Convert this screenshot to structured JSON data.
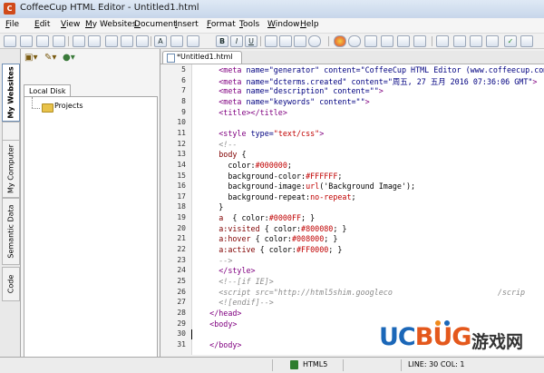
{
  "window": {
    "title": "CoffeeCup HTML Editor - Untitled1.html",
    "app_icon_letter": "C"
  },
  "menu": [
    "File",
    "Edit",
    "View",
    "My Websites",
    "Document",
    "Insert",
    "Format",
    "Tools",
    "Window",
    "Help"
  ],
  "toolbar": {
    "bold": "B",
    "italic": "I",
    "underline": "U",
    "font_icon": "A"
  },
  "side_tabs": [
    "My Websites",
    "My Computer",
    "Semantic Data",
    "Code"
  ],
  "side_panel": {
    "tab": "Local Disk",
    "tree": [
      "Projects"
    ]
  },
  "doc_tab": "*Untitled1.html",
  "editor": {
    "line_numbers": [
      "5",
      "6",
      "7",
      "8",
      "9",
      "10",
      "11",
      "12",
      "13",
      "14",
      "15",
      "16",
      "17",
      "18",
      "19",
      "20",
      "21",
      "22",
      "23",
      "24",
      "25",
      "26",
      "27",
      "28",
      "29",
      "30",
      "31"
    ],
    "lines": [
      [
        [
          "t-tag",
          "      <meta "
        ],
        [
          "t-attr",
          "name="
        ],
        [
          "t-str",
          "\"generator\""
        ],
        [
          "t-attr",
          " content="
        ],
        [
          "t-str",
          "\"CoffeeCup HTML Editor (www.coffeecup.com)\""
        ]
      ],
      [
        [
          "t-tag",
          "      <meta "
        ],
        [
          "t-attr",
          "name="
        ],
        [
          "t-str",
          "\"dcterms.created\""
        ],
        [
          "t-attr",
          " content="
        ],
        [
          "t-str",
          "\"周五, 27 五月 2016 07:36:06 GMT\""
        ],
        [
          "t-tag",
          ">"
        ]
      ],
      [
        [
          "t-tag",
          "      <meta "
        ],
        [
          "t-attr",
          "name="
        ],
        [
          "t-str",
          "\"description\""
        ],
        [
          "t-attr",
          " content="
        ],
        [
          "t-str",
          "\"\""
        ],
        [
          "t-tag",
          ">"
        ]
      ],
      [
        [
          "t-tag",
          "      <meta "
        ],
        [
          "t-attr",
          "name="
        ],
        [
          "t-str",
          "\"keywords\""
        ],
        [
          "t-attr",
          " content="
        ],
        [
          "t-str",
          "\"\""
        ],
        [
          "t-tag",
          ">"
        ]
      ],
      [
        [
          "t-tag",
          "      <title></title>"
        ]
      ],
      [
        [
          "t-txt",
          ""
        ]
      ],
      [
        [
          "t-tag",
          "      <style "
        ],
        [
          "t-attr",
          "type="
        ],
        [
          "t-val",
          "\"text/css\""
        ],
        [
          "t-tag",
          ">"
        ]
      ],
      [
        [
          "t-cmt",
          "      <!--"
        ]
      ],
      [
        [
          "t-sel",
          "      body "
        ],
        [
          "t-txt",
          "{"
        ]
      ],
      [
        [
          "t-prop",
          "        color:"
        ],
        [
          "t-val",
          "#000000"
        ],
        [
          "t-txt",
          ";"
        ]
      ],
      [
        [
          "t-prop",
          "        background-color:"
        ],
        [
          "t-val",
          "#FFFFFF"
        ],
        [
          "t-txt",
          ";"
        ]
      ],
      [
        [
          "t-prop",
          "        background-image:"
        ],
        [
          "t-val",
          "url"
        ],
        [
          "t-txt",
          "('Background Image');"
        ]
      ],
      [
        [
          "t-prop",
          "        background-repeat:"
        ],
        [
          "t-val",
          "no-repeat"
        ],
        [
          "t-txt",
          ";"
        ]
      ],
      [
        [
          "t-txt",
          "      }"
        ]
      ],
      [
        [
          "t-sel",
          "      a  "
        ],
        [
          "t-txt",
          "{ color:"
        ],
        [
          "t-val",
          "#0000FF"
        ],
        [
          "t-txt",
          "; }"
        ]
      ],
      [
        [
          "t-sel",
          "      a:visited "
        ],
        [
          "t-txt",
          "{ color:"
        ],
        [
          "t-val",
          "#800080"
        ],
        [
          "t-txt",
          "; }"
        ]
      ],
      [
        [
          "t-sel",
          "      a:hover "
        ],
        [
          "t-txt",
          "{ color:"
        ],
        [
          "t-val",
          "#008000"
        ],
        [
          "t-txt",
          "; }"
        ]
      ],
      [
        [
          "t-sel",
          "      a:active "
        ],
        [
          "t-txt",
          "{ color:"
        ],
        [
          "t-val",
          "#FF0000"
        ],
        [
          "t-txt",
          "; }"
        ]
      ],
      [
        [
          "t-cmt",
          "      -->"
        ]
      ],
      [
        [
          "t-tag",
          "      </style>"
        ]
      ],
      [
        [
          "t-cmt",
          "      <!--[if IE]>"
        ]
      ],
      [
        [
          "t-cmt",
          "      <script src=\"http://html5shim.googleco                       /scrip"
        ]
      ],
      [
        [
          "t-cmt",
          "      <![endif]-->"
        ]
      ],
      [
        [
          "t-tag",
          "    </head>"
        ]
      ],
      [
        [
          "t-tag",
          "    <body>"
        ]
      ],
      [
        [
          "t-txt",
          ""
        ]
      ],
      [
        [
          "t-tag",
          "    </body>"
        ]
      ]
    ]
  },
  "status": {
    "doctype": "HTML5",
    "position": "LINE: 30  COL: 1"
  },
  "watermark": {
    "logo_uc": "UC",
    "logo_bug": "BUG",
    "logo_cn": "游戏网"
  }
}
